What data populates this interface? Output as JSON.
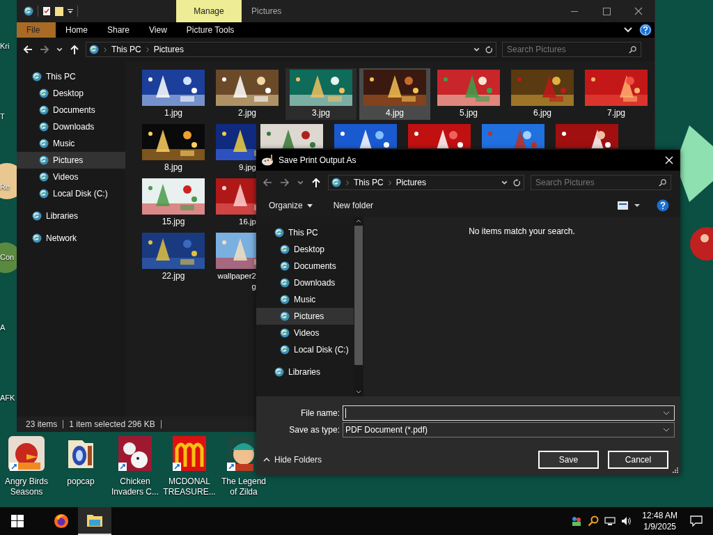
{
  "desktop": {
    "edge_labels": [
      "Kri",
      "T",
      "Re",
      "Con",
      "A",
      "AFK"
    ],
    "shortcuts": [
      {
        "label": "Angry Birds Seasons",
        "kind": "bird"
      },
      {
        "label": "popcap",
        "kind": "folder"
      },
      {
        "label": "Chicken Invaders C...",
        "kind": "chicken"
      },
      {
        "label": "MCDONAL TREASURE...",
        "kind": "arches"
      },
      {
        "label": "The Legend of Zilda",
        "kind": "hero"
      }
    ]
  },
  "explorer": {
    "context_tab": "Manage",
    "title": "Pictures",
    "ribbon_tabs": [
      {
        "label": "File",
        "kind": "file"
      },
      {
        "label": "Home",
        "kind": "tab"
      },
      {
        "label": "Share",
        "kind": "tab"
      },
      {
        "label": "View",
        "kind": "tab"
      },
      {
        "label": "Picture Tools",
        "kind": "tab"
      }
    ],
    "crumbs": [
      "This PC",
      "Pictures"
    ],
    "search": {
      "placeholder": "Search Pictures"
    },
    "nav": [
      {
        "label": "This PC",
        "selected": false,
        "children": [
          {
            "label": "Desktop",
            "selected": false
          },
          {
            "label": "Documents",
            "selected": false
          },
          {
            "label": "Downloads",
            "selected": false
          },
          {
            "label": "Music",
            "selected": false
          },
          {
            "label": "Pictures",
            "selected": true
          },
          {
            "label": "Videos",
            "selected": false
          },
          {
            "label": "Local Disk (C:)",
            "selected": false
          }
        ]
      },
      {
        "label": "Libraries",
        "selected": false
      },
      {
        "label": "Network",
        "selected": false
      }
    ],
    "file_rows": [
      [
        {
          "label": "1.jpg",
          "selected": false,
          "hovered": false
        },
        {
          "label": "2.jpg",
          "selected": false,
          "hovered": false
        },
        {
          "label": "3.jpg",
          "selected": false,
          "hovered": true
        },
        {
          "label": "4.jpg",
          "selected": true,
          "hovered": false
        },
        {
          "label": "5.jpg",
          "selected": false,
          "hovered": false
        },
        {
          "label": "6.jpg",
          "selected": false,
          "hovered": false
        },
        {
          "label": "7.jpg",
          "selected": false,
          "hovered": false
        }
      ],
      [
        {
          "label": "8.jpg",
          "selected": false,
          "hovered": false
        },
        {
          "label": "9.jpg",
          "selected": false,
          "hovered": false
        },
        {
          "selected": false,
          "hovered": false
        },
        {
          "selected": false,
          "hovered": false
        },
        {
          "selected": false,
          "hovered": false
        },
        {
          "selected": false,
          "hovered": false
        },
        {
          "selected": false,
          "hovered": false
        }
      ],
      [
        {
          "label": "15.jpg",
          "selected": false,
          "hovered": false
        },
        {
          "label": "16.jp",
          "selected": false,
          "hovered": false
        }
      ],
      [
        {
          "label": "22.jpg",
          "selected": false,
          "hovered": false
        },
        {
          "label": "wallpaper2\ng",
          "selected": false,
          "hovered": false
        }
      ]
    ],
    "status": {
      "count": "23 items",
      "selection": "1 item selected  296 KB"
    }
  },
  "dialog": {
    "title": "Save Print Output As",
    "crumbs": [
      "This PC",
      "Pictures"
    ],
    "search": {
      "placeholder": "Search Pictures"
    },
    "organize": "Organize",
    "new_folder": "New folder",
    "nav": [
      {
        "label": "This PC",
        "selected": false,
        "children": [
          {
            "label": "Desktop",
            "selected": false
          },
          {
            "label": "Documents",
            "selected": false
          },
          {
            "label": "Downloads",
            "selected": false
          },
          {
            "label": "Music",
            "selected": false
          },
          {
            "label": "Pictures",
            "selected": true
          },
          {
            "label": "Videos",
            "selected": false
          },
          {
            "label": "Local Disk (C:)",
            "selected": false
          }
        ]
      },
      {
        "label": "Libraries",
        "selected": false
      }
    ],
    "empty_message": "No items match your search.",
    "file_name": {
      "label": "File name:",
      "focused": true
    },
    "save_type": {
      "label": "Save as type:",
      "value": "PDF Document (*.pdf)"
    },
    "hide_folders": "Hide Folders",
    "buttons": [
      "Save",
      "Cancel"
    ]
  },
  "taskbar": {
    "apps": [
      {
        "kind": "browser",
        "selected": false
      },
      {
        "kind": "folder",
        "selected": true
      }
    ],
    "time": "12:48 AM",
    "date": "1/9/2025"
  }
}
